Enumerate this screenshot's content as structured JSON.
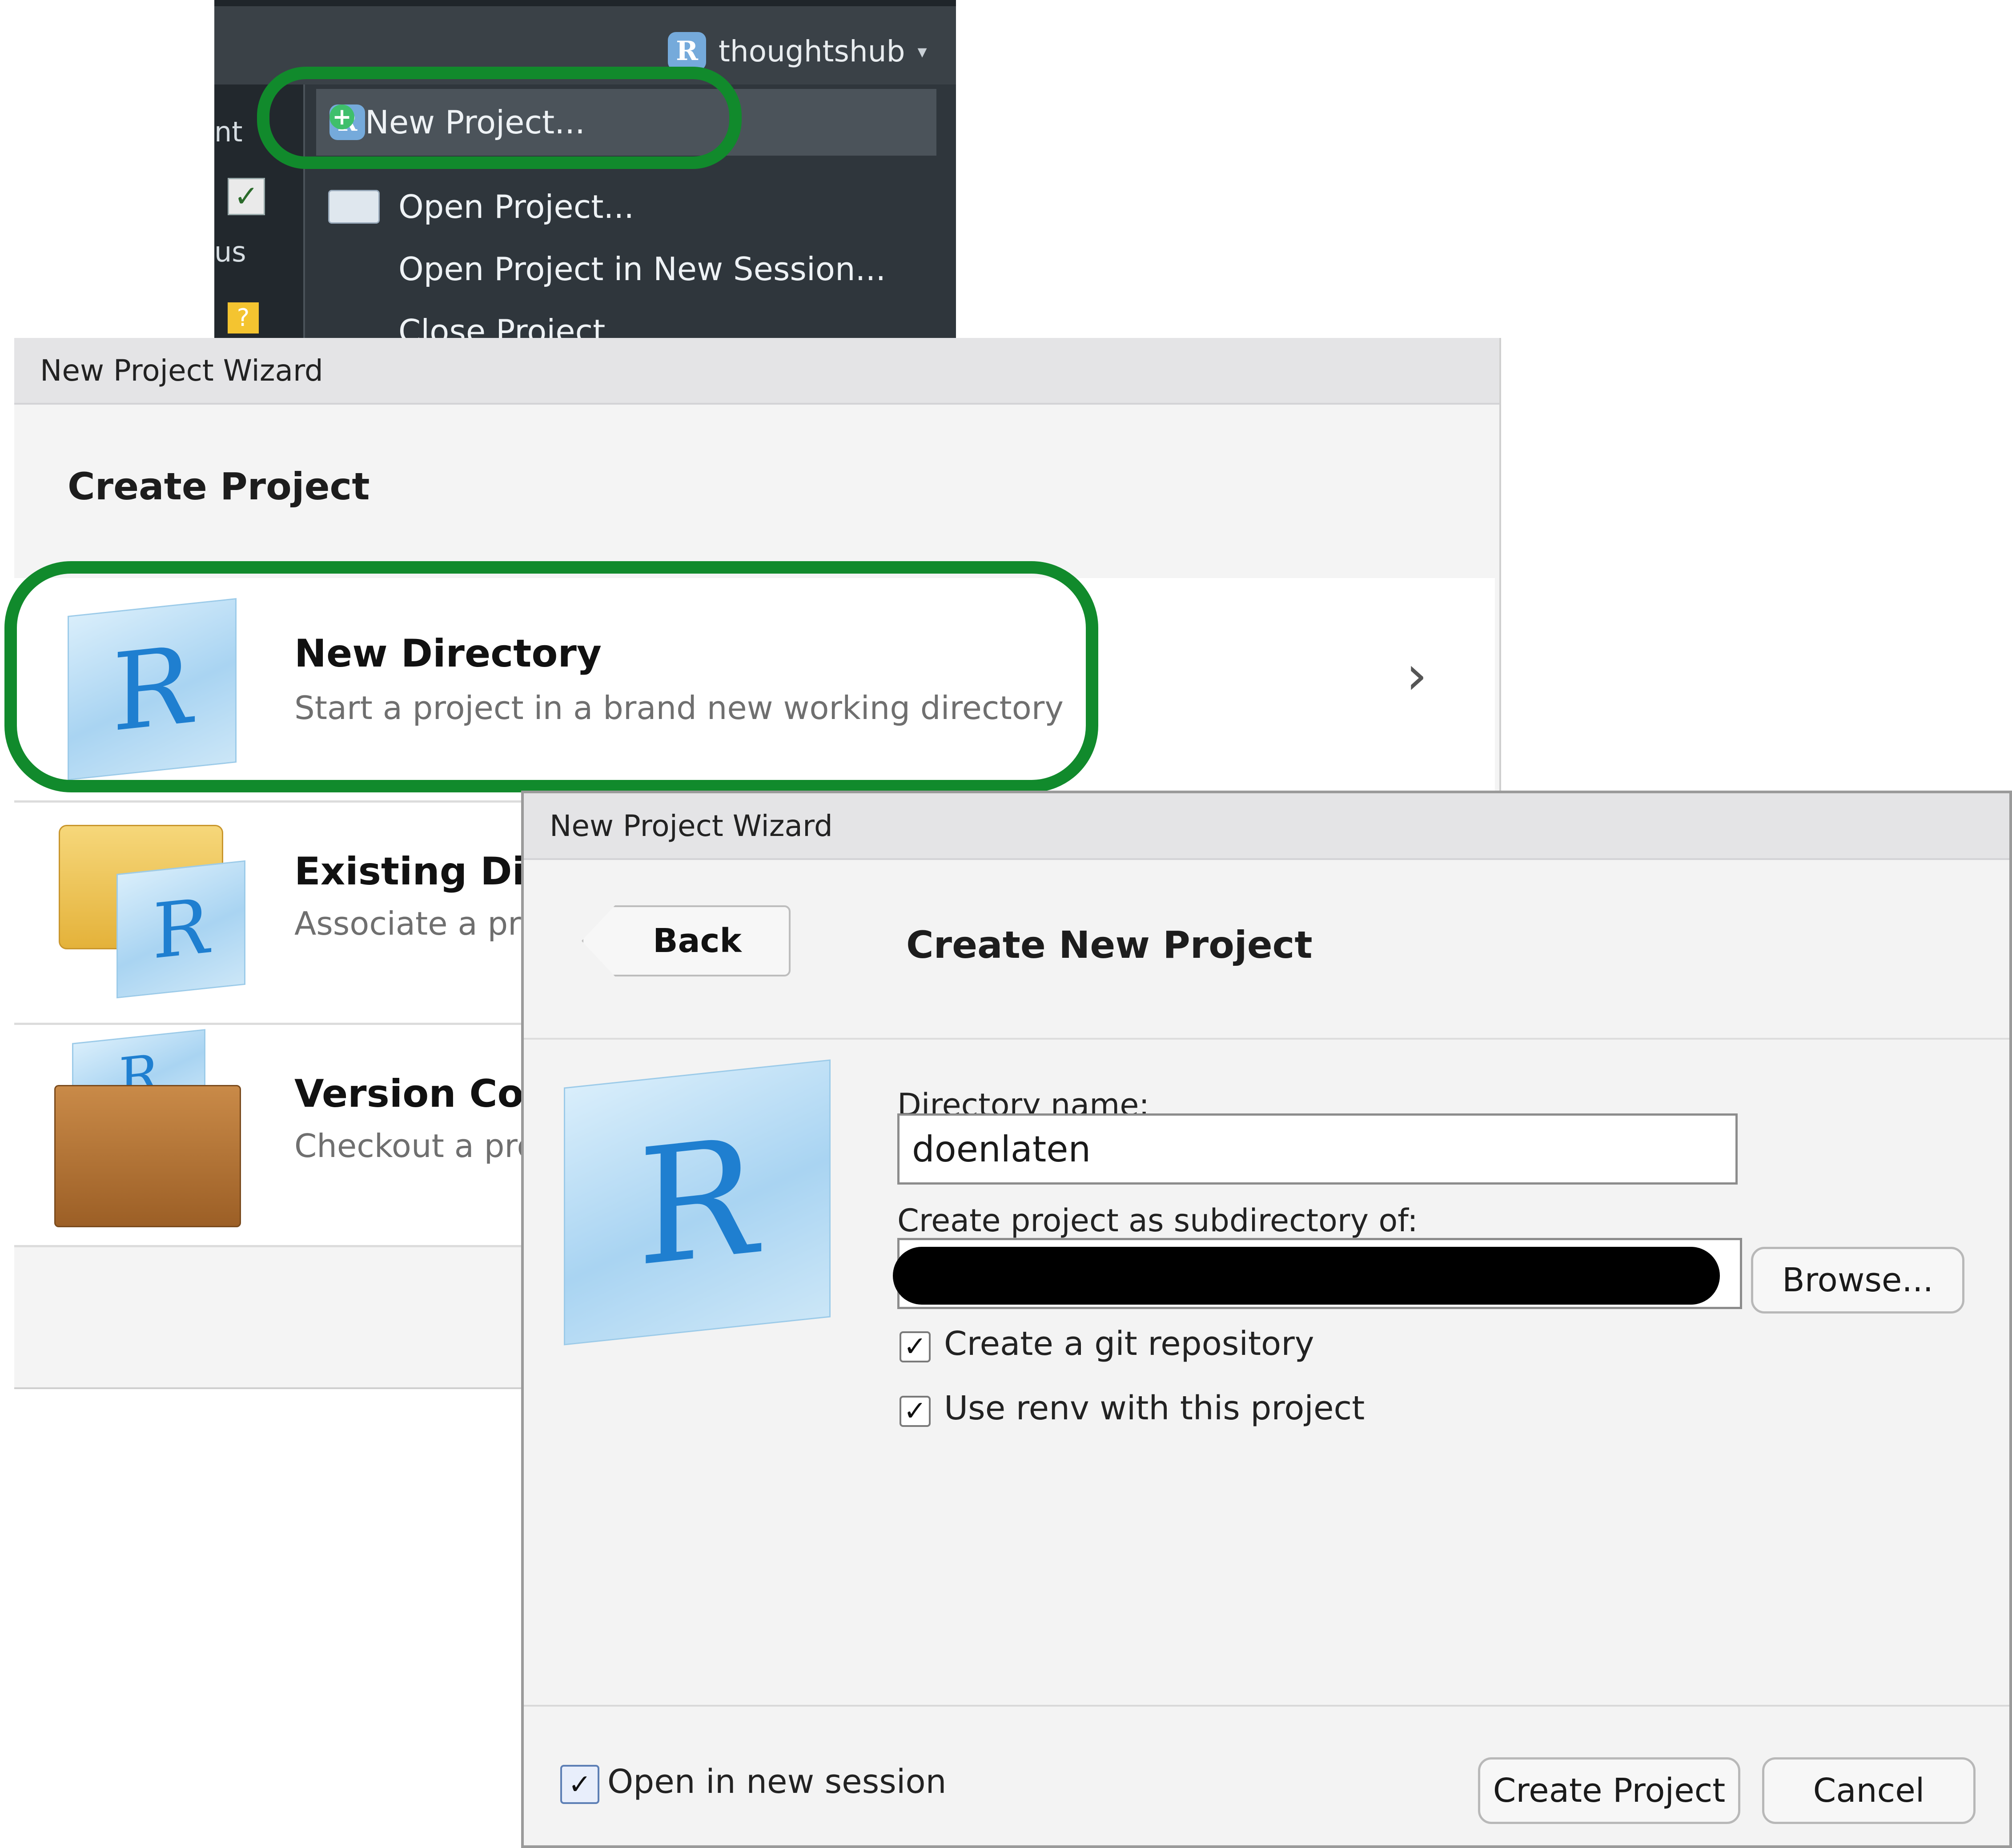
{
  "rstudio_menu": {
    "project_name": "thoughtshub",
    "left_labels": [
      "nt",
      "us"
    ],
    "items": [
      {
        "label": "New Project..."
      },
      {
        "label": "Open Project..."
      },
      {
        "label": "Open Project in New Session..."
      },
      {
        "label": "Close Project"
      }
    ]
  },
  "wizard1": {
    "window_title": "New Project Wizard",
    "heading": "Create Project",
    "options": [
      {
        "title": "New Directory",
        "subtitle": "Start a project in a brand new working directory"
      },
      {
        "title": "Existing Dire",
        "subtitle": "Associate a proj"
      },
      {
        "title": "Version Cont",
        "subtitle": "Checkout a proj"
      }
    ]
  },
  "wizard2": {
    "window_title": "New Project Wizard",
    "back_label": "Back",
    "heading": "Create New Project",
    "directory_label": "Directory name:",
    "directory_value": "doenlaten",
    "subdir_label": "Create project as subdirectory of:",
    "browse_label": "Browse...",
    "git_label": "Create a git repository",
    "git_checked": true,
    "renv_label": "Use renv with this project",
    "renv_checked": true,
    "open_session_label": "Open in new session",
    "open_session_checked": true,
    "create_label": "Create Project",
    "cancel_label": "Cancel"
  },
  "icons": {
    "r_logo": "r-cube-icon",
    "check": "✓",
    "chevron": "›",
    "caret": "▾"
  },
  "colors": {
    "highlight": "#118a2c",
    "menu_bg": "#2f363c",
    "r_blue": "#1f7fd0"
  }
}
